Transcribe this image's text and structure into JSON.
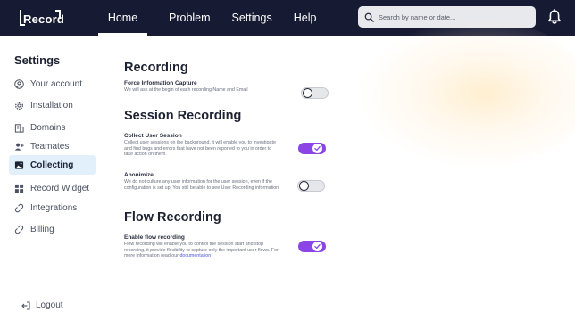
{
  "app": {
    "logo": "Record"
  },
  "nav": {
    "items": [
      {
        "label": "Home",
        "active": true
      },
      {
        "label": "Problem",
        "active": false
      },
      {
        "label": "Settings",
        "active": false
      },
      {
        "label": "Help",
        "active": false
      }
    ]
  },
  "search": {
    "placeholder": "Search by name or date...",
    "icon": "search-icon"
  },
  "header": {
    "notification_icon": "bell-icon"
  },
  "sidebar": {
    "title": "Settings",
    "items": [
      {
        "label": "Your account",
        "icon": "user-circle-icon",
        "active": false
      },
      {
        "label": "Installation",
        "icon": "gear-icon",
        "active": false
      },
      {
        "label": "Domains",
        "icon": "building-icon",
        "active": false
      },
      {
        "label": "Teamates",
        "icon": "add-user-icon",
        "active": false
      },
      {
        "label": "Collecting",
        "icon": "image-icon",
        "active": true
      },
      {
        "label": "Record Widget",
        "icon": "widgets-icon",
        "active": false
      },
      {
        "label": "Integrations",
        "icon": "link-icon",
        "active": false
      },
      {
        "label": "Billing",
        "icon": "link-icon",
        "active": false
      }
    ],
    "logout": {
      "label": "Logout",
      "icon": "logout-icon"
    }
  },
  "main": {
    "recording": {
      "title": "Recording",
      "force_capture": {
        "title": "Force Information Capture",
        "description": "We will ask at the begin of each recording Name and Email",
        "enabled": false
      }
    },
    "session_recording": {
      "title": "Session Recording",
      "collect": {
        "title": "Collect User Session",
        "description": "Collect user sessions on the background, it will enable you to investigate and find bugs and errors that have not been reported to you in order to take action on them.",
        "enabled": true
      },
      "anonimize": {
        "title": "Anonimize",
        "description": "We do not culture any user information for the user session, even if the configuration is set up. You still be able to see User Recording information",
        "enabled": false
      }
    },
    "flow_recording": {
      "title": "Flow Recording",
      "enable_flow": {
        "title": "Enable flow recording",
        "description": "Flow recording will enable you to control the session start and stop recording, it provide flexibility to capture only the important user flows. For more information read our",
        "link_text": "documentation",
        "enabled": true
      }
    }
  },
  "colors": {
    "topbar": "#161a33",
    "accent": "#8b45e6",
    "active_sidebar": "#e1f0fb"
  }
}
